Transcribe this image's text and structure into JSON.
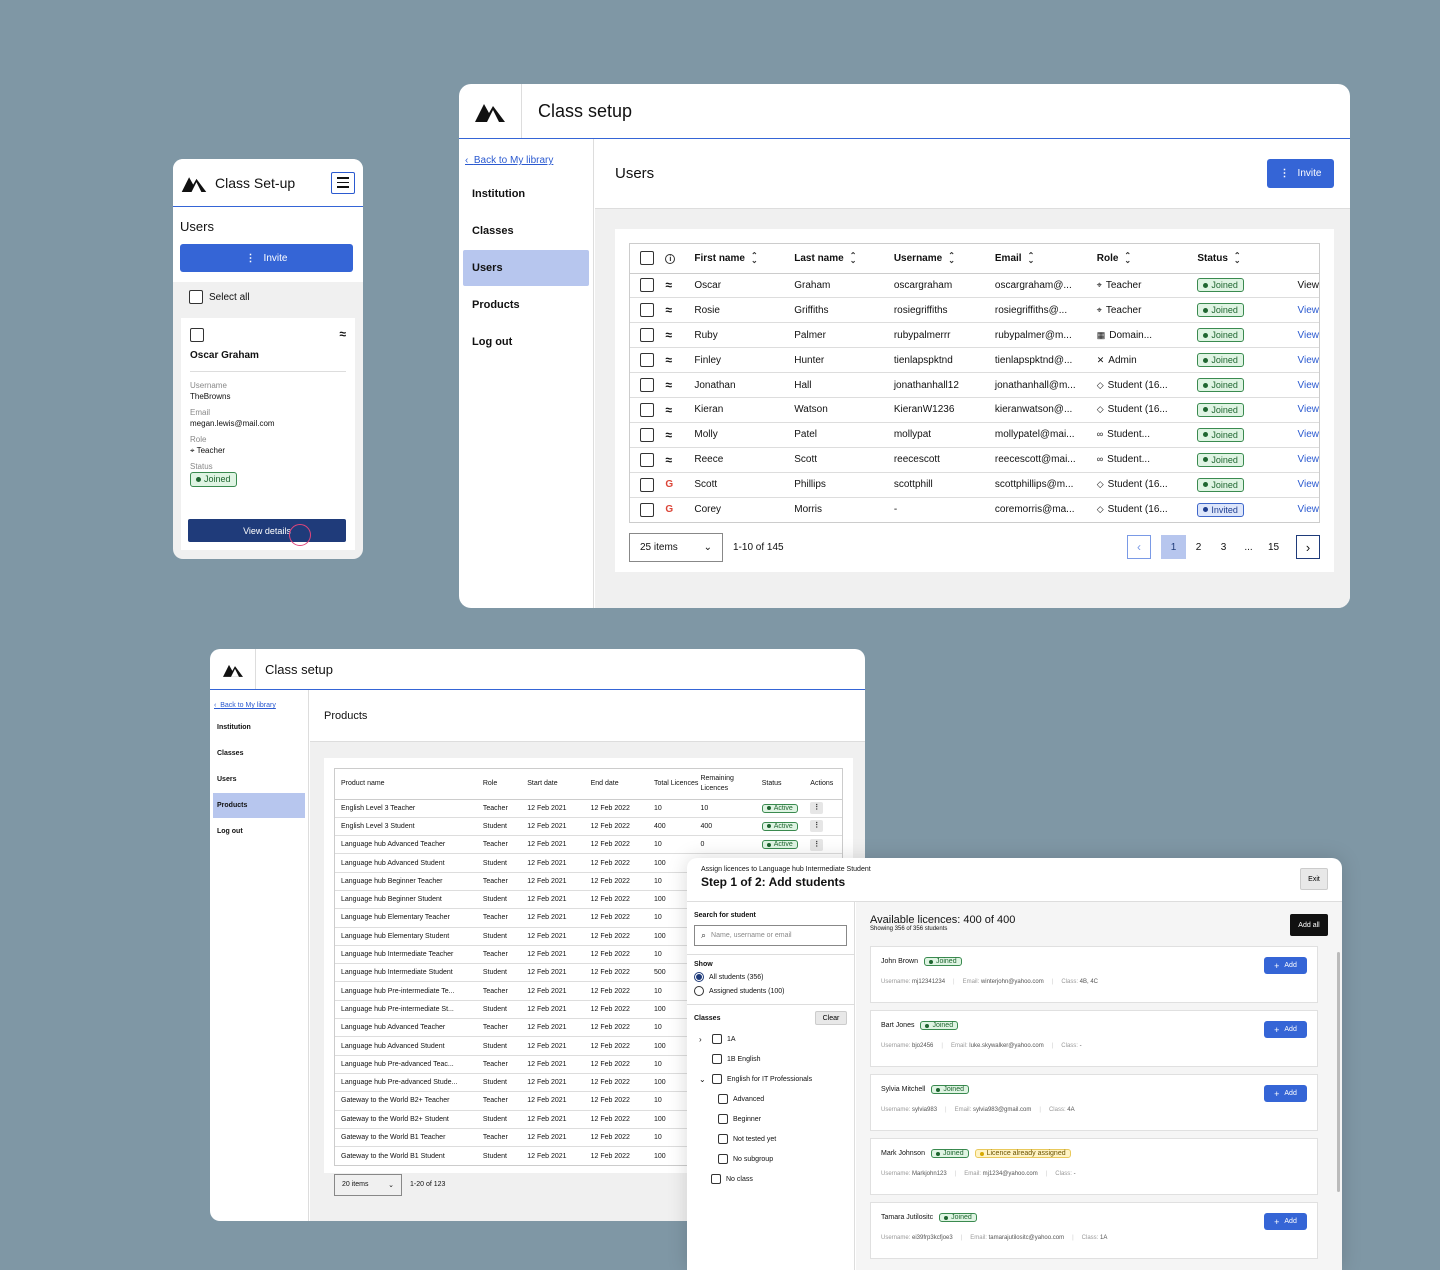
{
  "mobile": {
    "title": "Class Set-up",
    "section": "Users",
    "invite_label": "Invite",
    "select_all": "Select all",
    "card": {
      "name": "Oscar Graham",
      "username_label": "Username",
      "username": "TheBrowns",
      "email_label": "Email",
      "email": "megan.lewis@mail.com",
      "role_label": "Role",
      "role": "Teacher",
      "status_label": "Status",
      "status": "Joined",
      "view_details": "View details"
    }
  },
  "users_window": {
    "title": "Class setup",
    "back": "Back to My library",
    "nav": [
      "Institution",
      "Classes",
      "Users",
      "Products",
      "Log out"
    ],
    "active_nav": "Users",
    "page_title": "Users",
    "invite_label": "Invite",
    "columns": [
      "First name",
      "Last name",
      "Username",
      "Email",
      "Role",
      "Status"
    ],
    "rows": [
      {
        "icon": "waves",
        "first": "Oscar",
        "last": "Graham",
        "username": "oscargraham",
        "email": "oscargraham@...",
        "role_icon": "tag",
        "role": "Teacher",
        "status": "Joined",
        "action": "View"
      },
      {
        "icon": "waves",
        "first": "Rosie",
        "last": "Griffiths",
        "username": "rosiegriffiths",
        "email": "rosiegriffiths@...",
        "role_icon": "tag",
        "role": "Teacher",
        "status": "Joined",
        "action": "View"
      },
      {
        "icon": "waves",
        "first": "Ruby",
        "last": "Palmer",
        "username": "rubypalmerrr",
        "email": "rubypalmer@m...",
        "role_icon": "building",
        "role": "Domain...",
        "status": "Joined",
        "action": "View"
      },
      {
        "icon": "waves",
        "first": "Finley",
        "last": "Hunter",
        "username": "tienlapspktnd",
        "email": "tienlapspktnd@...",
        "role_icon": "tools",
        "role": "Admin",
        "status": "Joined",
        "action": "View"
      },
      {
        "icon": "waves",
        "first": "Jonathan",
        "last": "Hall",
        "username": "jonathanhall12",
        "email": "jonathanhall@m...",
        "role_icon": "cap",
        "role": "Student (16...",
        "status": "Joined",
        "action": "View"
      },
      {
        "icon": "waves",
        "first": "Kieran",
        "last": "Watson",
        "username": "KieranW1236",
        "email": "kieranwatson@...",
        "role_icon": "cap",
        "role": "Student (16...",
        "status": "Joined",
        "action": "View"
      },
      {
        "icon": "waves",
        "first": "Molly",
        "last": "Patel",
        "username": "mollypat",
        "email": "mollypatel@mai...",
        "role_icon": "glasses",
        "role": "Student...",
        "status": "Joined",
        "action": "View"
      },
      {
        "icon": "waves",
        "first": "Reece",
        "last": "Scott",
        "username": "reecescott",
        "email": "reecescott@mai...",
        "role_icon": "glasses",
        "role": "Student...",
        "status": "Joined",
        "action": "View"
      },
      {
        "icon": "google",
        "first": "Scott",
        "last": "Phillips",
        "username": "scottphill",
        "email": "scottphillips@m...",
        "role_icon": "cap",
        "role": "Student (16...",
        "status": "Joined",
        "action": "View"
      },
      {
        "icon": "google",
        "first": "Corey",
        "last": "Morris",
        "username": "-",
        "email": "coremorris@ma...",
        "role_icon": "cap",
        "role": "Student (16...",
        "status": "Invited",
        "action": "View"
      }
    ],
    "per_page": "25 items",
    "range": "1-10 of 145",
    "pages": [
      "1",
      "2",
      "3",
      "...",
      "15"
    ],
    "current_page": "1"
  },
  "products_window": {
    "title": "Class setup",
    "back": "Back to My library",
    "nav": [
      "Institution",
      "Classes",
      "Users",
      "Products",
      "Log out"
    ],
    "active_nav": "Products",
    "page_title": "Products",
    "columns": [
      "Product  name",
      "Role",
      "Start date",
      "End date",
      "Total Licences",
      "Remaining Licences",
      "Status",
      "Actions"
    ],
    "rows": [
      [
        "English Level 3 Teacher",
        "Teacher",
        "12 Feb 2021",
        "12 Feb 2022",
        "10",
        "10",
        "Active"
      ],
      [
        "English Level 3 Student",
        "Student",
        "12 Feb 2021",
        "12 Feb 2022",
        "400",
        "400",
        "Active"
      ],
      [
        "Language hub Advanced Teacher",
        "Teacher",
        "12 Feb 2021",
        "12 Feb 2022",
        "10",
        "0",
        "Active"
      ],
      [
        "Language hub Advanced Student",
        "Student",
        "12 Feb 2021",
        "12 Feb 2022",
        "100",
        "",
        ""
      ],
      [
        "Language hub Beginner Teacher",
        "Teacher",
        "12 Feb 2021",
        "12 Feb 2022",
        "10",
        "",
        ""
      ],
      [
        "Language hub Beginner Student",
        "Student",
        "12 Feb 2021",
        "12 Feb 2022",
        "100",
        "",
        ""
      ],
      [
        "Language hub Elementary Teacher",
        "Teacher",
        "12 Feb 2021",
        "12 Feb 2022",
        "10",
        "",
        ""
      ],
      [
        "Language hub Elementary Student",
        "Student",
        "12 Feb 2021",
        "12 Feb 2022",
        "100",
        "",
        ""
      ],
      [
        "Language hub Intermediate Teacher",
        "Teacher",
        "12 Feb 2021",
        "12 Feb 2022",
        "10",
        "",
        ""
      ],
      [
        "Language hub Intermediate Student",
        "Student",
        "12 Feb 2021",
        "12 Feb 2022",
        "500",
        "",
        ""
      ],
      [
        "Language hub Pre-intermediate Te...",
        "Teacher",
        "12 Feb 2021",
        "12 Feb 2022",
        "10",
        "",
        ""
      ],
      [
        "Language hub Pre-intermediate St...",
        "Student",
        "12 Feb 2021",
        "12 Feb 2022",
        "100",
        "",
        ""
      ],
      [
        "Language hub Advanced Teacher",
        "Teacher",
        "12 Feb 2021",
        "12 Feb 2022",
        "10",
        "",
        ""
      ],
      [
        "Language hub Advanced Student",
        "Student",
        "12 Feb 2021",
        "12 Feb 2022",
        "100",
        "",
        ""
      ],
      [
        "Language hub Pre-advanced Teac...",
        "Teacher",
        "12 Feb 2021",
        "12 Feb 2022",
        "10",
        "",
        ""
      ],
      [
        "Language hub Pre-advanced Stude...",
        "Student",
        "12 Feb 2021",
        "12 Feb 2022",
        "100",
        "",
        ""
      ],
      [
        "Gateway to the World B2+ Teacher",
        "Teacher",
        "12 Feb 2021",
        "12 Feb 2022",
        "10",
        "",
        ""
      ],
      [
        "Gateway to the World B2+ Student",
        "Student",
        "12 Feb 2021",
        "12 Feb 2022",
        "100",
        "",
        ""
      ],
      [
        "Gateway to the World B1 Teacher",
        "Teacher",
        "12 Feb 2021",
        "12 Feb 2022",
        "10",
        "",
        ""
      ],
      [
        "Gateway to the World B1 Student",
        "Student",
        "12 Feb 2021",
        "12 Feb 2022",
        "100",
        "",
        ""
      ]
    ],
    "per_page": "20 items",
    "range": "1-20 of 123"
  },
  "assign_window": {
    "subtitle": "Assign licences to Language hub Intermediate Student",
    "title": "Step 1 of 2: Add students",
    "exit": "Exit",
    "search_label": "Search for student",
    "search_placeholder": "Name, username or email",
    "show_label": "Show",
    "show_options": [
      "All students (356)",
      "Assigned students (100)"
    ],
    "classes_label": "Classes",
    "clear": "Clear",
    "classes": [
      {
        "label": "1A",
        "level": 0,
        "chevron": "right"
      },
      {
        "label": "1B English",
        "level": 0,
        "chevron": ""
      },
      {
        "label": "English for IT Professionals",
        "level": 0,
        "chevron": "down"
      },
      {
        "label": "Advanced",
        "level": 1,
        "chevron": ""
      },
      {
        "label": "Beginner",
        "level": 1,
        "chevron": ""
      },
      {
        "label": "Not tested yet",
        "level": 1,
        "chevron": ""
      },
      {
        "label": "No subgroup",
        "level": 1,
        "chevron": ""
      },
      {
        "label": "No class",
        "level": -1,
        "chevron": ""
      }
    ],
    "available_title": "Available licences: 400 of 400",
    "showing": "Showing 356 of 356 students",
    "add_all": "Add all",
    "add_label": "Add",
    "students": [
      {
        "name": "John Brown",
        "status": "Joined",
        "extra": "",
        "username": "mj12341234",
        "email": "winterjohn@yahoo.com",
        "class": "4B, 4C",
        "can_add": true
      },
      {
        "name": "Bart Jones",
        "status": "Joined",
        "extra": "",
        "username": "bjo2456",
        "email": "luke.skywalker@yahoo.com",
        "class": "-",
        "can_add": true
      },
      {
        "name": "Sylvia Mitchell",
        "status": "Joined",
        "extra": "",
        "username": "sylvia983",
        "email": "sylvia983@gmail.com",
        "class": "4A",
        "can_add": true
      },
      {
        "name": "Mark Johnson",
        "status": "Joined",
        "extra": "Licence already assigned",
        "username": "Markjohn123",
        "email": "mj1234@yahoo.com",
        "class": "-",
        "can_add": false
      },
      {
        "name": "Tamara Jutilositc",
        "status": "Joined",
        "extra": "",
        "username": "ei39frp3kcfjoe3",
        "email": "tamarajutilositc@yahoo.com",
        "class": "1A",
        "can_add": true
      }
    ],
    "username_label": "Username:",
    "email_label": "Email:",
    "class_label": "Class:"
  },
  "colors": {
    "primary": "#3565d6",
    "nav_active": "#b7c6ee",
    "dark_button": "#1f3b7a",
    "background": "#7f97a5"
  }
}
